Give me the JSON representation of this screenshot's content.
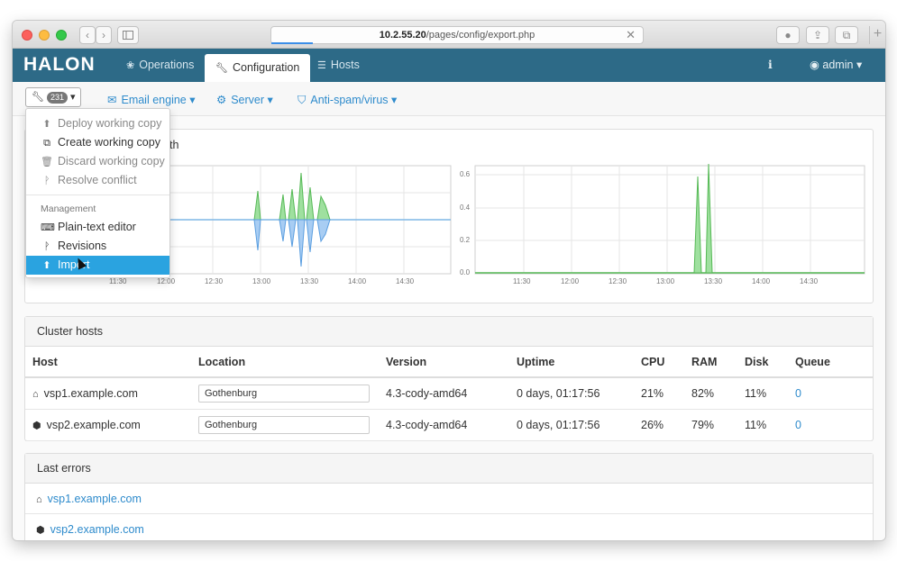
{
  "browser": {
    "url_host": "10.2.55.20",
    "url_path": "/pages/config/export.php",
    "back_glyph": "‹",
    "forward_glyph": "›"
  },
  "navbar": {
    "brand": "HALON",
    "tabs": [
      {
        "label": "Operations",
        "icon": "group-icon"
      },
      {
        "label": "Configuration",
        "icon": "wrench-icon",
        "active": true
      },
      {
        "label": "Hosts",
        "icon": "list-icon"
      }
    ],
    "user": "admin"
  },
  "subbar": {
    "badge": "231",
    "links": [
      {
        "label": "Email engine",
        "icon": "envelope-icon"
      },
      {
        "label": "Server",
        "icon": "gear-icon"
      },
      {
        "label": "Anti-spam/virus",
        "icon": "shield-icon"
      }
    ]
  },
  "dropdown": {
    "items": [
      {
        "label": "Deploy working copy",
        "icon": "upload-icon",
        "disabled": true
      },
      {
        "label": "Create working copy",
        "icon": "copy-icon",
        "disabled": false
      },
      {
        "label": "Discard working copy",
        "icon": "trash-icon",
        "disabled": true
      },
      {
        "label": "Resolve conflict",
        "icon": "merge-icon",
        "disabled": true
      }
    ],
    "header": "Management",
    "management_items": [
      {
        "label": "Plain-text editor",
        "icon": "keyboard-icon"
      },
      {
        "label": "Revisions",
        "icon": "branch-icon"
      },
      {
        "label": "Import",
        "icon": "upload-icon",
        "active": true
      }
    ]
  },
  "charts": {
    "title_fragment": "th",
    "left": {
      "x_ticks": [
        "11:30",
        "12:00",
        "12:30",
        "13:00",
        "13:30",
        "14:00",
        "14:30"
      ]
    },
    "right": {
      "y_ticks": [
        "0.0",
        "0.2",
        "0.4",
        "0.6"
      ],
      "x_ticks": [
        "11:30",
        "12:00",
        "12:30",
        "13:00",
        "13:30",
        "14:00",
        "14:30"
      ]
    }
  },
  "cluster": {
    "title": "Cluster hosts",
    "columns": [
      "Host",
      "Location",
      "Version",
      "Uptime",
      "CPU",
      "RAM",
      "Disk",
      "Queue"
    ],
    "rows": [
      {
        "icon": "home-icon",
        "host": "vsp1.example.com",
        "location": "Gothenburg",
        "version": "4.3-cody-amd64",
        "uptime": "0 days, 01:17:56",
        "cpu": "21%",
        "ram": "82%",
        "disk": "11%",
        "queue": "0"
      },
      {
        "icon": "cube-icon",
        "host": "vsp2.example.com",
        "location": "Gothenburg",
        "version": "4.3-cody-amd64",
        "uptime": "0 days, 01:17:56",
        "cpu": "26%",
        "ram": "79%",
        "disk": "11%",
        "queue": "0"
      }
    ]
  },
  "errors": {
    "title": "Last errors",
    "rows": [
      {
        "icon": "home-icon",
        "host": "vsp1.example.com"
      },
      {
        "icon": "cube-icon",
        "host": "vsp2.example.com"
      }
    ]
  }
}
